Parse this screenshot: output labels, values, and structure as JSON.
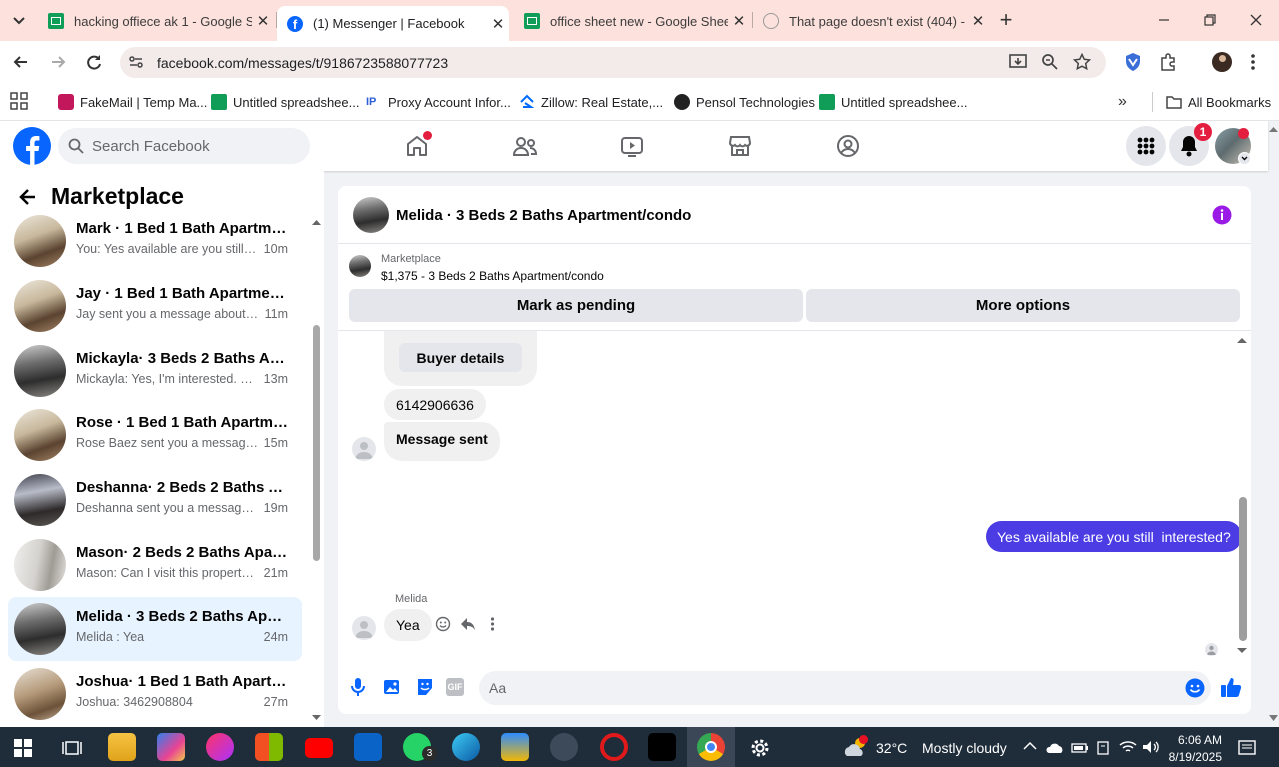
{
  "browser": {
    "tabs": [
      {
        "title": "hacking offiece ak 1 - Google Sh",
        "icon": "sheets-icon",
        "active": false
      },
      {
        "title": "(1) Messenger | Facebook",
        "icon": "facebook-icon",
        "active": true
      },
      {
        "title": "office sheet new - Google Sheet",
        "icon": "sheets-icon",
        "active": false
      },
      {
        "title": "That page doesn't exist (404) - R",
        "icon": "error-page-icon",
        "active": false
      }
    ],
    "url": "facebook.com/messages/t/9186723588077723",
    "bookmarks": [
      {
        "label": "FakeMail | Temp Ma...",
        "icon": "fakemail-icon"
      },
      {
        "label": "Untitled spreadshee...",
        "icon": "sheets-icon"
      },
      {
        "label": "Proxy Account Infor...",
        "icon": "proxy-icon"
      },
      {
        "label": "Zillow: Real Estate,...",
        "icon": "zillow-icon"
      },
      {
        "label": "Pensol Technologies",
        "icon": "pensol-icon"
      },
      {
        "label": "Untitled spreadshee...",
        "icon": "sheets-icon"
      }
    ],
    "all_bookmarks": "All Bookmarks"
  },
  "fb": {
    "search_placeholder": "Search Facebook",
    "notification_count": "1"
  },
  "sidebar": {
    "title": "Marketplace",
    "conversations": [
      {
        "name": "Mark · 1 Bed 1 Bath Apartment/...",
        "preview": "You: Yes available are you still int...",
        "time": "10m"
      },
      {
        "name": "Jay · 1 Bed 1 Bath Apartment/co...",
        "preview": "Jay sent you a message about yo...",
        "time": "11m"
      },
      {
        "name": "Mickayla· 3 Beds 2 Baths Apart...",
        "preview": "Mickayla: Yes, I'm interested. My ...",
        "time": "13m"
      },
      {
        "name": "Rose · 1 Bed 1 Bath Apartment/c...",
        "preview": "Rose Baez sent you a message a...",
        "time": "15m"
      },
      {
        "name": "Deshanna· 2 Beds 2 Baths Apart...",
        "preview": "Deshanna sent you a message ab...",
        "time": "19m"
      },
      {
        "name": "Mason· 2 Beds 2 Baths Apartme...",
        "preview": "Mason: Can I visit this property? ...",
        "time": "21m"
      },
      {
        "name": "Melida · 3 Beds 2 Baths Apartm...",
        "preview": "Melida : Yea",
        "time": "24m",
        "selected": true
      },
      {
        "name": "Joshua· 1 Bed 1 Bath Apartment...",
        "preview": "Joshua: 3462908804",
        "time": "27m"
      }
    ]
  },
  "chat": {
    "title": "Melida · 3 Beds 2 Baths Apartment/condo",
    "listing_source": "Marketplace",
    "listing": "$1,375 - 3 Beds 2 Baths Apartment/condo",
    "mark_pending": "Mark as pending",
    "more_options": "More options",
    "buyer_details": "Buyer details",
    "msg_phone": "6142906636",
    "msg_sent": "Message sent",
    "my_msg": "Yes available are you still  interested?",
    "sender": "Melida",
    "last_msg": "Yea",
    "composer_placeholder": "Aa"
  },
  "taskbar": {
    "whatsapp_badge": "3",
    "temperature": "32°C",
    "weather": "Mostly cloudy",
    "time": "6:06 AM",
    "date": "8/19/2025"
  },
  "colors": {
    "fb_blue": "#0866ff",
    "messenger_bubble": "#4b3ce4",
    "selected_conv": "#e7f3ff",
    "tab_strip": "#fde1dc",
    "taskbar": "#1f2c3a"
  }
}
